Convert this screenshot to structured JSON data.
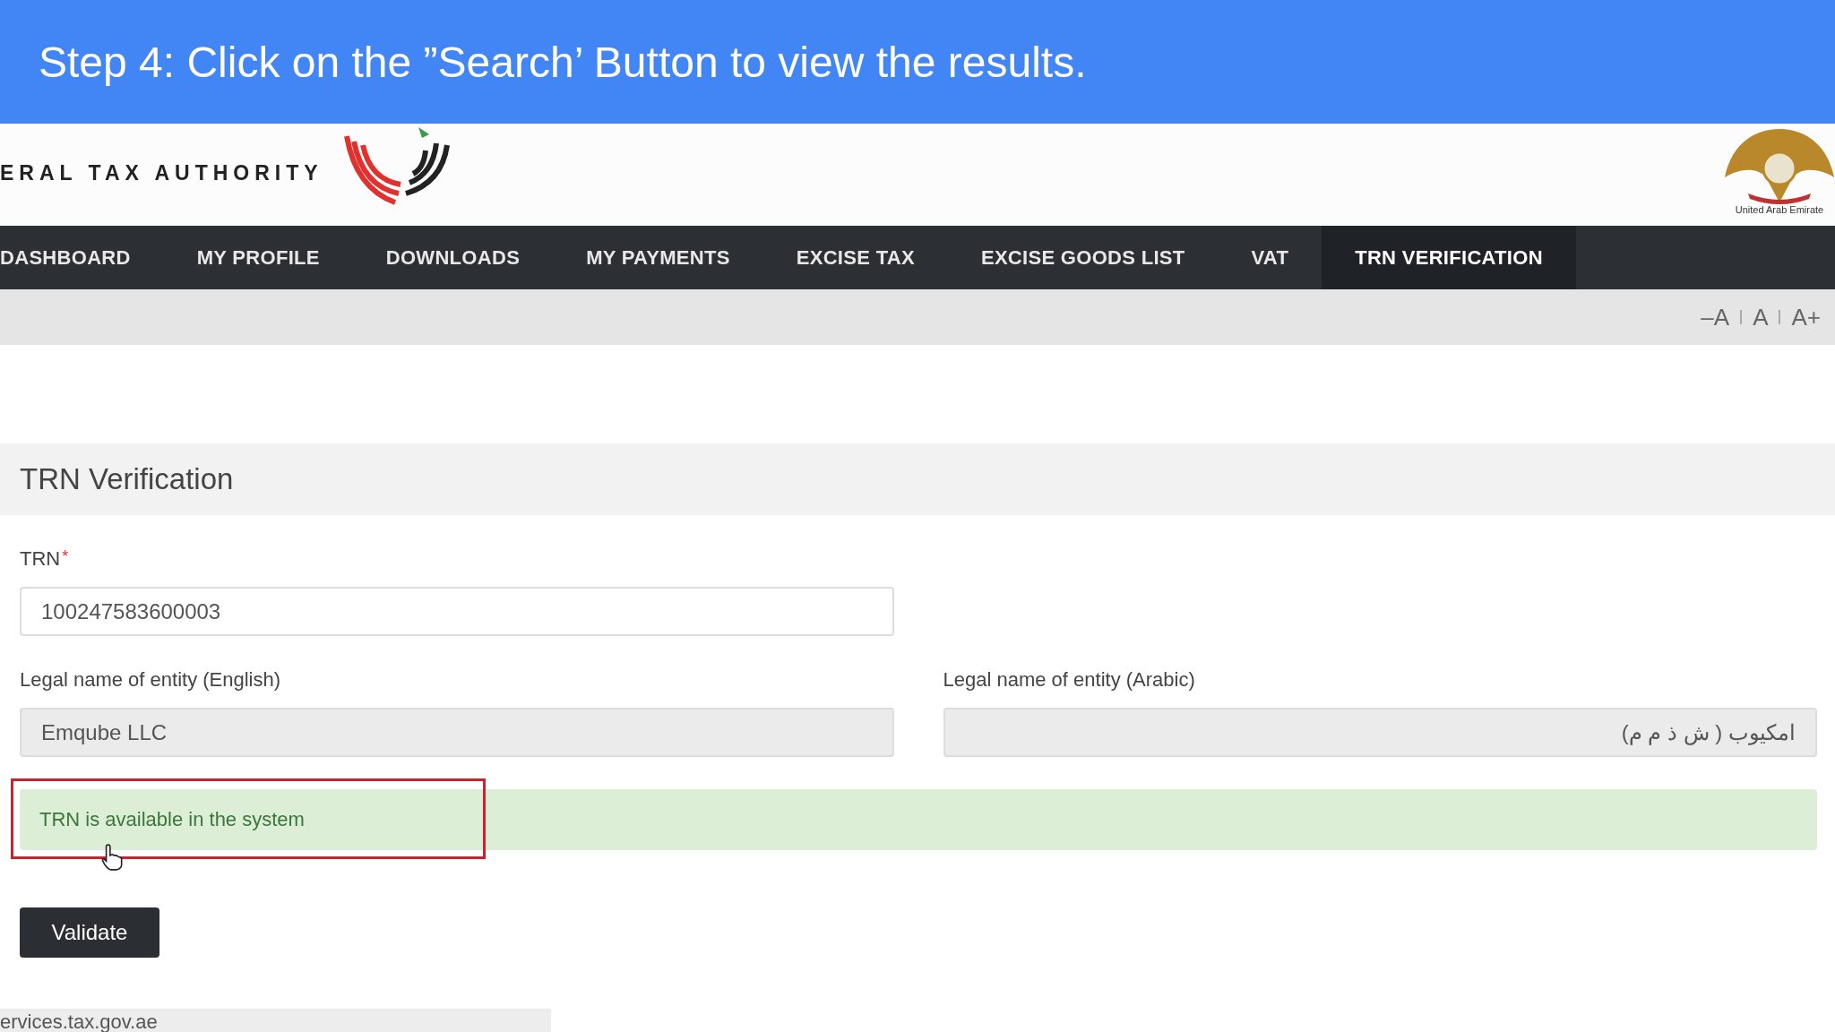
{
  "banner": {
    "text": "Step 4: Click on the ”Search’ Button to view the results."
  },
  "header": {
    "authority_name": "ERAL TAX AUTHORITY",
    "emblem_caption": "United Arab Emirate"
  },
  "nav": [
    {
      "label": "DASHBOARD",
      "selected": false
    },
    {
      "label": "MY PROFILE",
      "selected": false
    },
    {
      "label": "DOWNLOADS",
      "selected": false
    },
    {
      "label": "MY PAYMENTS",
      "selected": false
    },
    {
      "label": "EXCISE TAX",
      "selected": false
    },
    {
      "label": "EXCISE GOODS LIST",
      "selected": false
    },
    {
      "label": "VAT",
      "selected": false
    },
    {
      "label": "TRN VERIFICATION",
      "selected": true
    }
  ],
  "font_controls": [
    "–A",
    "A",
    "A+"
  ],
  "section_title": "TRN Verification",
  "form": {
    "trn": {
      "label": "TRN",
      "required_mark": "*",
      "value": "100247583600003",
      "disabled": false
    },
    "names": [
      {
        "label": "Legal name of entity (English)",
        "value": "Emqube LLC",
        "disabled": true,
        "kind": "english"
      },
      {
        "label": "Legal name of entity (Arabic)",
        "value": "امكيوب ( ش ذ م م)",
        "disabled": true,
        "kind": "arabic"
      }
    ]
  },
  "alert": {
    "text": "TRN is available in the system",
    "highlighted": true
  },
  "validate_button": "Validate",
  "footer": {
    "text": "ervices.tax.gov.ae"
  }
}
